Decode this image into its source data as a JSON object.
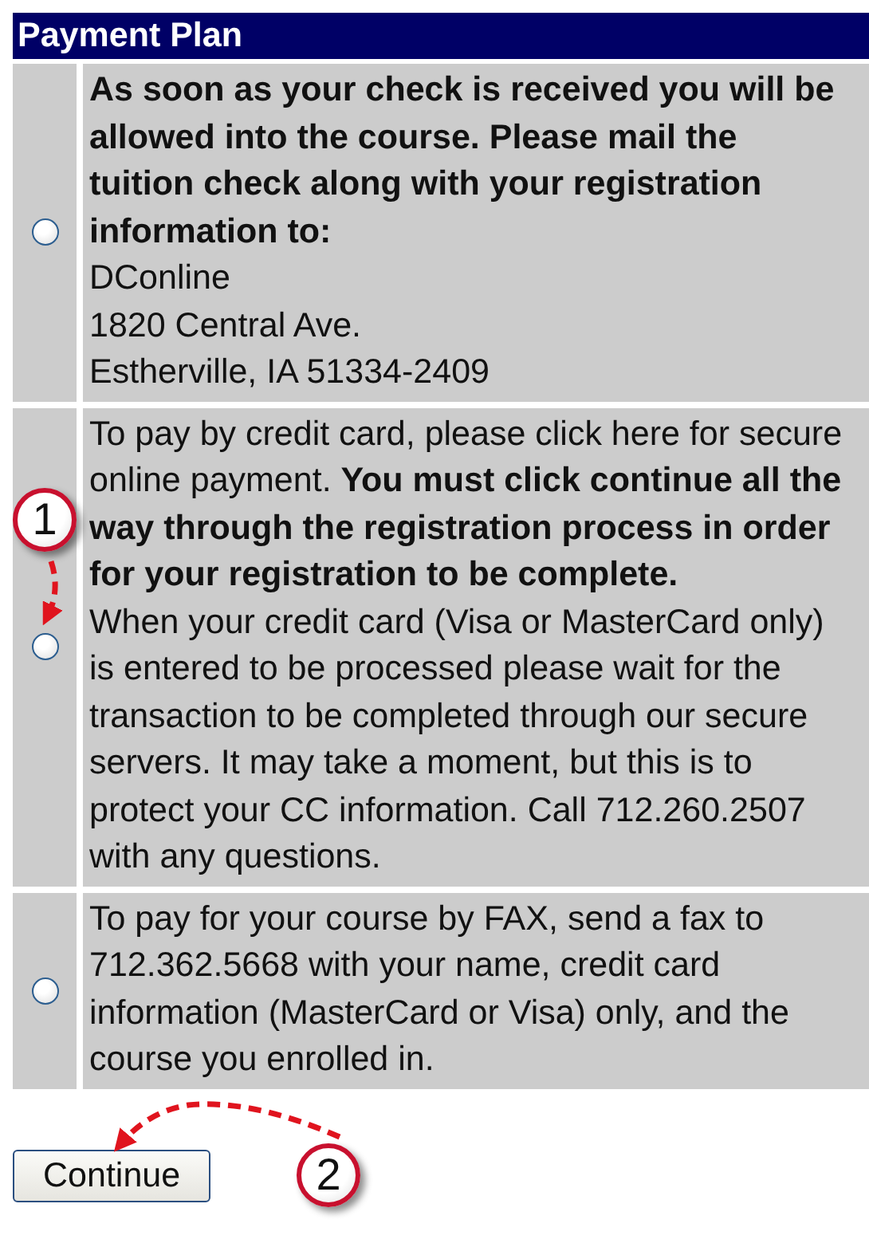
{
  "table": {
    "title": "Payment Plan",
    "options": [
      {
        "selected": false,
        "paragraphs": [
          "**As soon as your check is received you will be allowed into the course. Please mail the tuition check along with your registration information to:**"
        ],
        "address": [
          "DConline",
          "1820 Central Ave.",
          "Estherville, IA 51334-2409"
        ]
      },
      {
        "selected": false,
        "paragraphs": [
          "To pay by credit card, please click here for secure online payment. **You must click continue all the way through the registration process in order for your registration to be complete.**",
          "When your credit card (Visa or MasterCard only) is entered to be processed please wait for the transaction to be completed through our secure servers. It may take a moment, but this is to protect your CC information. Call 712.260.2507 with any questions."
        ]
      },
      {
        "selected": false,
        "paragraphs": [
          "To pay for your course by FAX, send a fax to 712.362.5668 with your name, credit card information (MasterCard or Visa) only, and the course you enrolled in."
        ]
      }
    ]
  },
  "button": "Continue",
  "annotations": [
    {
      "number": "1"
    },
    {
      "number": "2"
    }
  ]
}
